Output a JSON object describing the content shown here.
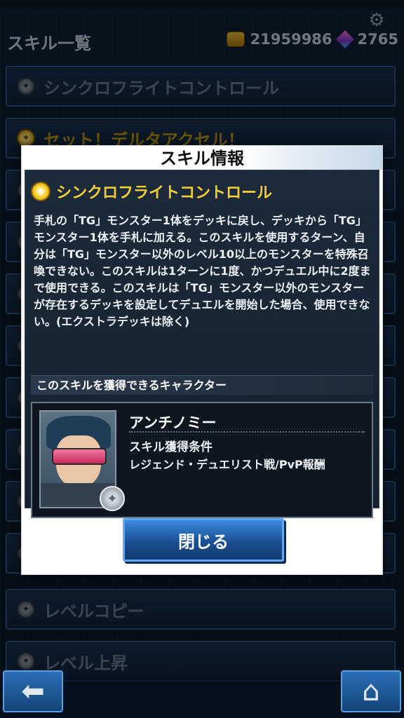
{
  "header": {
    "title": "スキル一覧",
    "coins": "21959986",
    "gems": "2765"
  },
  "skill_list": [
    {
      "label": "シンクロフライトコントロール",
      "style": "normal"
    },
    {
      "label": "セット！デルタアクセル！",
      "style": "gold"
    },
    {
      "label": "レベルコピー",
      "style": "normal"
    },
    {
      "label": "レベル上昇",
      "style": "normal"
    }
  ],
  "modal": {
    "title": "スキル情報",
    "skill_name": "シンクロフライトコントロール",
    "description": "手札の「TG」モンスター1体をデッキに戻し、デッキから「TG」モンスター1体を手札に加える。このスキルを使用するターン、自分は「TG」モンスター以外のレベル10以上のモンスターを特殊召喚できない。このスキルは1ターンに1度、かつデュエル中に2度まで使用できる。このスキルは「TG」モンスター以外のモンスターが存在するデッキを設定してデュエルを開始した場合、使用できない。(エクストラデッキは除く)",
    "section_title": "このスキルを獲得できるキャラクター",
    "character_name": "アンチノミー",
    "condition_label": "スキル獲得条件",
    "condition_value": "レジェンド・デュエリスト戦/PvP報酬",
    "close_label": "閉じる"
  },
  "icons": {
    "skill_normal": "skill-gray-icon",
    "skill_gold": "skill-star-icon",
    "back": "arrow-left-icon",
    "home": "home-icon",
    "settings": "settings-icon"
  }
}
